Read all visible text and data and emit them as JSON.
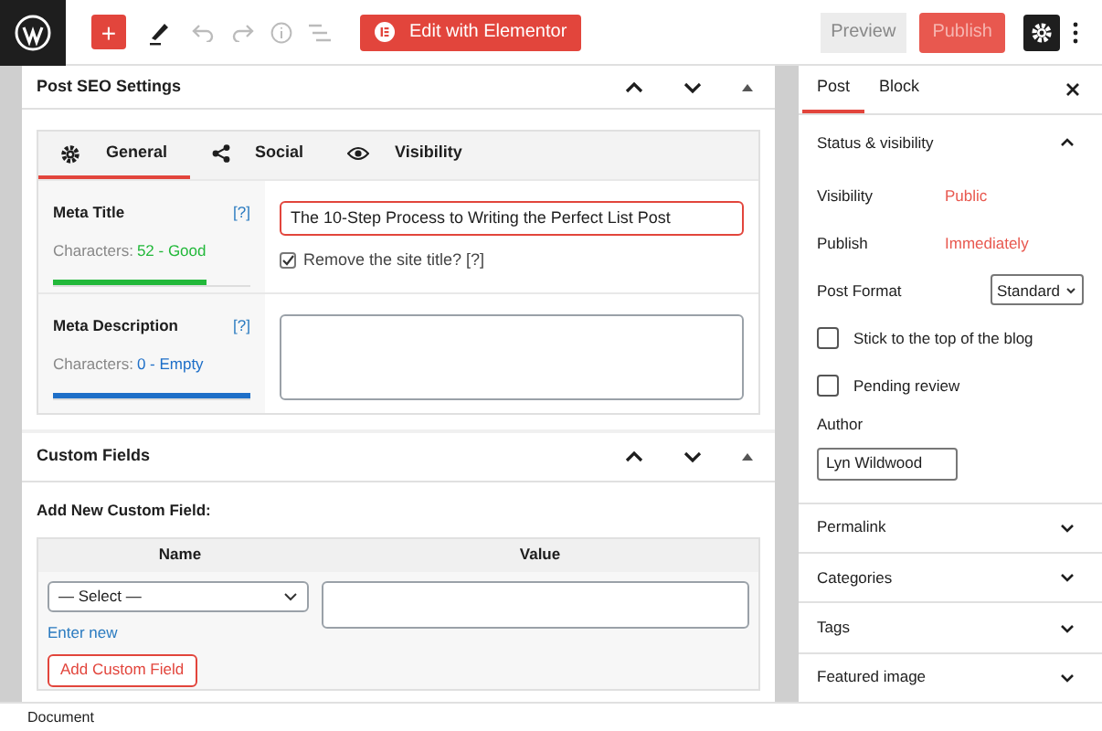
{
  "toolbar": {
    "add_button": "+",
    "elementor_button": "Edit with Elementor",
    "preview_button": "Preview",
    "publish_button": "Publish",
    "settings_selected": true
  },
  "seo_panel": {
    "title": "Post SEO Settings",
    "tabs": [
      {
        "label": "General",
        "selected": true
      },
      {
        "label": "Social",
        "selected": false
      },
      {
        "label": "Visibility",
        "selected": false
      }
    ],
    "meta_fields": [
      {
        "kind": "input",
        "label": "Meta Title",
        "help": "[?]",
        "characters_label": "Characters:",
        "count": "52 - Good",
        "level": 0.78,
        "color": "#22b83a",
        "value": "The 10-Step Process to Writing the Perfect List Post",
        "checkbox": {
          "label": "Remove the site title? [?]",
          "checked": true
        }
      },
      {
        "kind": "textarea",
        "label": "Meta Description",
        "help": "[?]",
        "characters_label": "Characters:",
        "count": "0 - Empty",
        "level": 1,
        "color": "#1e6fc8"
      }
    ]
  },
  "custom_fields": {
    "title": "Custom Fields",
    "subtitle": "Add New Custom Field:",
    "columns": [
      "Name",
      "Value"
    ],
    "select_value": "— Select —",
    "link": "Enter new",
    "button": "Add Custom Field"
  },
  "sidebar": {
    "tabs": [
      {
        "label": "Post",
        "selected": true
      },
      {
        "label": "Block",
        "selected": false
      }
    ],
    "status_section": {
      "title": "Status & visibility",
      "expanded": true,
      "rows": [
        {
          "label": "Visibility",
          "value": "Public"
        },
        {
          "label": "Publish",
          "value": "Immediately"
        }
      ],
      "post_format": {
        "label": "Post Format",
        "value": "Standard"
      },
      "checkboxes": [
        {
          "label": "Stick to the top of the blog",
          "checked": false
        },
        {
          "label": "Pending review",
          "checked": false
        }
      ],
      "author": {
        "label": "Author",
        "value": "Lyn Wildwood"
      }
    },
    "sections": [
      {
        "title": "Permalink",
        "expanded": false
      },
      {
        "title": "Categories",
        "expanded": false
      },
      {
        "title": "Tags",
        "expanded": false
      },
      {
        "title": "Featured image",
        "expanded": false
      }
    ]
  },
  "status_bar": "Document"
}
